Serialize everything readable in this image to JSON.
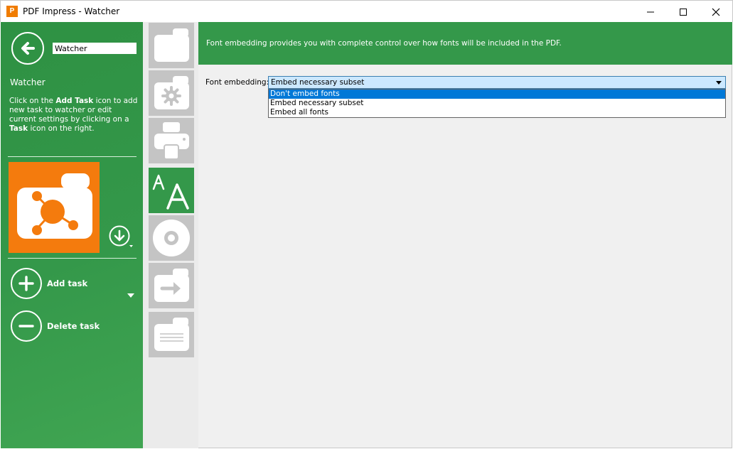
{
  "window": {
    "title": "PDF Impress - Watcher",
    "icon": "pdf-impress-app-icon"
  },
  "sidebar": {
    "name_value": "Watcher",
    "heading": "Watcher",
    "help_1": "Click on the ",
    "help_2": "Add Task",
    "help_3": " icon to add new task to watcher or edit current settings by clicking on a ",
    "help_4": "Task",
    "help_5": " icon on the right.",
    "add_task_label": "Add task",
    "delete_task_label": "Delete task"
  },
  "strip": {
    "items": [
      {
        "name": "folder-icon",
        "active": false
      },
      {
        "name": "settings-icon",
        "active": false
      },
      {
        "name": "printer-icon",
        "active": false
      },
      {
        "name": "font-icon",
        "active": true
      },
      {
        "name": "disc-icon",
        "active": false
      },
      {
        "name": "export-icon",
        "active": false
      },
      {
        "name": "document-icon",
        "active": false
      }
    ]
  },
  "content": {
    "banner": "Font embedding provides you with complete control over how fonts will be included in the PDF.",
    "field_label": "Font embedding:",
    "select_value": "Embed necessary subset",
    "options": [
      "Don't embed fonts",
      "Embed necessary subset",
      "Embed all fonts"
    ],
    "highlighted_option": "Don't embed fonts"
  },
  "colors": {
    "green": "#34984a",
    "orange": "#f47b0d",
    "highlight": "#0078d7"
  }
}
